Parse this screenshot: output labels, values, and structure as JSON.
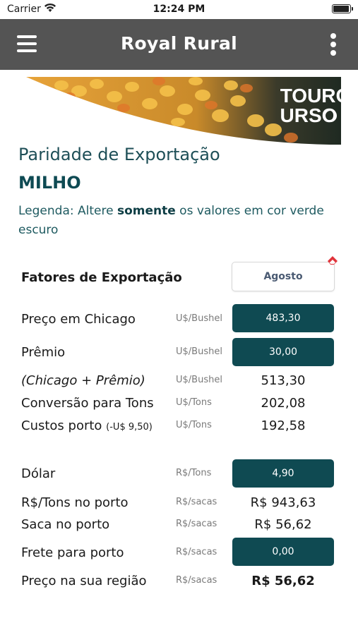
{
  "status_bar": {
    "carrier": "Carrier",
    "time": "12:24 PM"
  },
  "app_bar": {
    "title": "Royal Rural"
  },
  "banner": {
    "brand_line1": "TOURO",
    "brand_line2": "URSO"
  },
  "page": {
    "title": "Paridade de Exportação",
    "product": "MILHO",
    "legend_prefix": "Legenda: Altere ",
    "legend_bold": "somente",
    "legend_suffix": " os valores em cor verde escuro"
  },
  "factors": {
    "heading": "Fatores de Exportação",
    "month_button": "Agosto"
  },
  "rows": {
    "chicago": {
      "label": "Preço em Chicago",
      "unit": "U$/Bushel",
      "value": "483,30"
    },
    "premio": {
      "label": "Prêmio",
      "unit": "U$/Bushel",
      "value": "30,00"
    },
    "chicago_premio": {
      "label": "(Chicago + Prêmio)",
      "unit": "U$/Bushel",
      "value": "513,30"
    },
    "conversao": {
      "label": "Conversão para Tons",
      "unit": "U$/Tons",
      "value": "202,08"
    },
    "custos": {
      "label": "Custos porto",
      "label_note": "(-U$ 9,50)",
      "unit": "U$/Tons",
      "value": "192,58"
    },
    "dolar": {
      "label": "Dólar",
      "unit": "R$/Tons",
      "value": "4,90"
    },
    "rs_tons": {
      "label": "R$/Tons no porto",
      "unit": "R$/sacas",
      "value": "R$ 943,63"
    },
    "saca": {
      "label": "Saca no porto",
      "unit": "R$/sacas",
      "value": "R$ 56,62"
    },
    "frete": {
      "label": "Frete para porto",
      "unit": "R$/sacas",
      "value": "0,00"
    },
    "regiao": {
      "label": "Preço na sua região",
      "unit": "R$/sacas",
      "value": "R$ 56,62"
    }
  },
  "colors": {
    "app_bar": "#545454",
    "input_fill": "#0f4a52",
    "heading_teal": "#1e4f57",
    "eraser_red": "#e0333a"
  }
}
